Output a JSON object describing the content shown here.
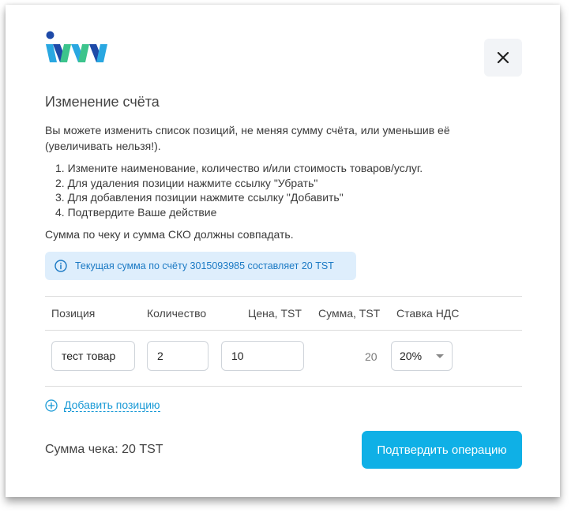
{
  "dialog": {
    "title": "Изменение счёта",
    "intro": "Вы можете изменить список позиций, не меняя сумму счёта, или уменьшив её (увеличивать нельзя!).",
    "steps": [
      "1. Измените наименование, количество и/или стоимость товаров/услуг.",
      "2. Для удаления позиции нажмите ссылку \"Убрать\"",
      "3. Для добавления позиции нажмите ссылку \"Добавить\"",
      "4. Подтвердите Ваше действие"
    ],
    "note": "Сумма по чеку и сумма СКО должны совпадать.",
    "info": "Текущая сумма по счёту 3015093985 составляет 20 TST"
  },
  "table": {
    "headers": [
      "Позиция",
      "Количество",
      "Цена, TST",
      "Сумма, TST",
      "Ставка НДС"
    ],
    "row": {
      "name": "тест товар",
      "quantity": "2",
      "price": "10",
      "sum": "20",
      "vat": "20%"
    }
  },
  "add_position": "Добавить позицию",
  "total": "Сумма чека: 20 TST",
  "confirm_button": "Подтвердить операцию",
  "icons": {
    "logo": "im-logo",
    "close": "close-icon",
    "info": "info-icon",
    "add": "plus-circle-icon",
    "caret": "chevron-down-icon"
  },
  "colors": {
    "accent": "#0fb0e6",
    "link": "#1a9ad6",
    "info_bg": "#deeefc",
    "info_text": "#1a79c4"
  }
}
